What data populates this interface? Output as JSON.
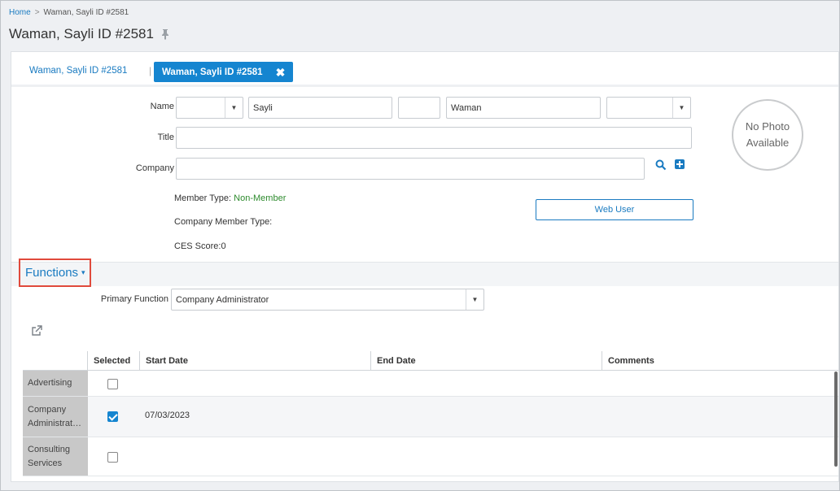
{
  "breadcrumb": {
    "home": "Home",
    "separator": ">",
    "current": "Waman, Sayli ID #2581"
  },
  "page_title": "Waman, Sayli ID #2581",
  "tabs": {
    "link_label": "Waman, Sayli ID #2581",
    "separator": "|",
    "active_label": "Waman, Sayli ID #2581",
    "close": "✖"
  },
  "form": {
    "name_label": "Name",
    "prefix_value": "",
    "first_name": "Sayli",
    "middle_name": "",
    "last_name": "Waman",
    "suffix_value": "",
    "title_label": "Title",
    "title_value": "",
    "company_label": "Company",
    "company_value": ""
  },
  "photo": {
    "line1": "No Photo",
    "line2": "Available"
  },
  "info": {
    "member_type_label": "Member Type: ",
    "member_type_value": "Non-Member",
    "company_member_type_label": "Company Member Type:",
    "ces_score_label": "CES Score:",
    "ces_score_value": "0"
  },
  "web_user_button": "Web User",
  "functions": {
    "heading": "Functions",
    "caret": "▾",
    "primary_function_label": "Primary Function",
    "primary_function_value": "Company Administrator",
    "columns": [
      "Selected",
      "Start Date",
      "End Date",
      "Comments"
    ],
    "rows": [
      {
        "name": "Advertising",
        "selected": false,
        "start_date": ""
      },
      {
        "name": "Company Administrat…",
        "selected": true,
        "start_date": "07/03/2023"
      },
      {
        "name": "Consulting Services",
        "selected": false,
        "start_date": ""
      }
    ]
  },
  "colors": {
    "accent": "#1585d0",
    "link": "#1a7bc1",
    "highlight": "#e04a3c",
    "green": "#2e8b2e"
  }
}
